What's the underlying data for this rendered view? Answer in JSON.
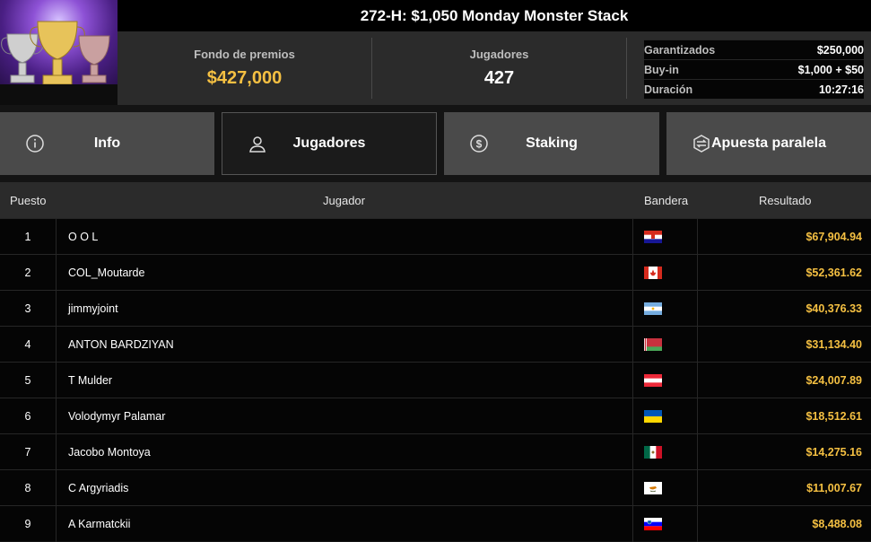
{
  "tournament": {
    "title": "272-H: $1,050 Monday Monster Stack",
    "prize_pool_label": "Fondo de premios",
    "prize_pool": "$427,000",
    "players_label": "Jugadores",
    "players": "427",
    "details": [
      {
        "label": "Garantizados",
        "value": "$250,000"
      },
      {
        "label": "Buy-in",
        "value": "$1,000 + $50"
      },
      {
        "label": "Duración",
        "value": "10:27:16"
      }
    ]
  },
  "tabs": [
    {
      "label": "Info",
      "icon": "info-icon",
      "active": false
    },
    {
      "label": "Jugadores",
      "icon": "user-icon",
      "active": true
    },
    {
      "label": "Staking",
      "icon": "dollar-icon",
      "active": false
    },
    {
      "label": "Apuesta paralela",
      "icon": "side-bet-icon",
      "active": false
    }
  ],
  "table": {
    "headers": {
      "position": "Puesto",
      "player": "Jugador",
      "flag": "Bandera",
      "result": "Resultado"
    },
    "rows": [
      {
        "pos": "1",
        "name": "O O L",
        "flag": "croatia",
        "result": "$67,904.94"
      },
      {
        "pos": "2",
        "name": "COL_Moutarde",
        "flag": "canada",
        "result": "$52,361.62"
      },
      {
        "pos": "3",
        "name": "jimmyjoint",
        "flag": "argentina",
        "result": "$40,376.33"
      },
      {
        "pos": "4",
        "name": "ANTON BARDZIYAN",
        "flag": "belarus",
        "result": "$31,134.40"
      },
      {
        "pos": "5",
        "name": "T Mulder",
        "flag": "austria",
        "result": "$24,007.89"
      },
      {
        "pos": "6",
        "name": "Volodymyr Palamar",
        "flag": "ukraine",
        "result": "$18,512.61"
      },
      {
        "pos": "7",
        "name": "Jacobo Montoya",
        "flag": "mexico",
        "result": "$14,275.16"
      },
      {
        "pos": "8",
        "name": "C Argyriadis",
        "flag": "cyprus",
        "result": "$11,007.67"
      },
      {
        "pos": "9",
        "name": "A Karmatckii",
        "flag": "slovenia",
        "result": "$8,488.08"
      }
    ]
  },
  "colors": {
    "accent": "#f5c042",
    "tab": "#4a4a4a",
    "tab_active": "#1b1b1b"
  }
}
